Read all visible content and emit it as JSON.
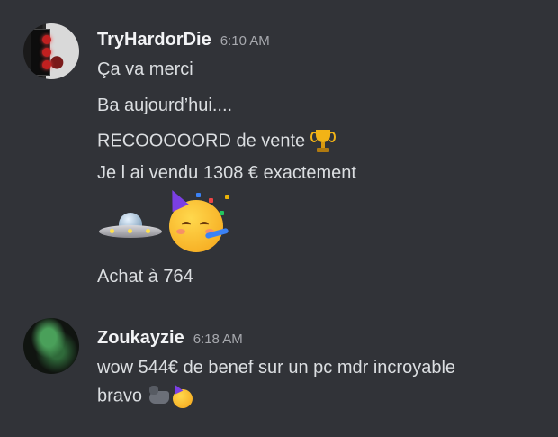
{
  "messages": [
    {
      "author": "TryHardorDie",
      "time": "6:10 AM",
      "lines": [
        "Ça va merci",
        "Ba aujourd’hui....",
        "RECOOOOORD de vente",
        "Je l ai vendu 1308 € exactement",
        "Achat à 764"
      ],
      "emojis": [
        "trophy-icon",
        "ufo-icon",
        "partying-face-icon"
      ]
    },
    {
      "author": "Zoukayzie",
      "time": "6:18 AM",
      "lines": [
        "wow 544€ de benef sur un pc mdr incroyable",
        "bravo"
      ],
      "emojis": [
        "flexed-biceps-icon",
        "partying-face-icon"
      ]
    }
  ],
  "colors": {
    "background": "#313338",
    "username": "#f2f3f5",
    "timestamp": "#a7a9ae",
    "text": "#dbdee1"
  }
}
